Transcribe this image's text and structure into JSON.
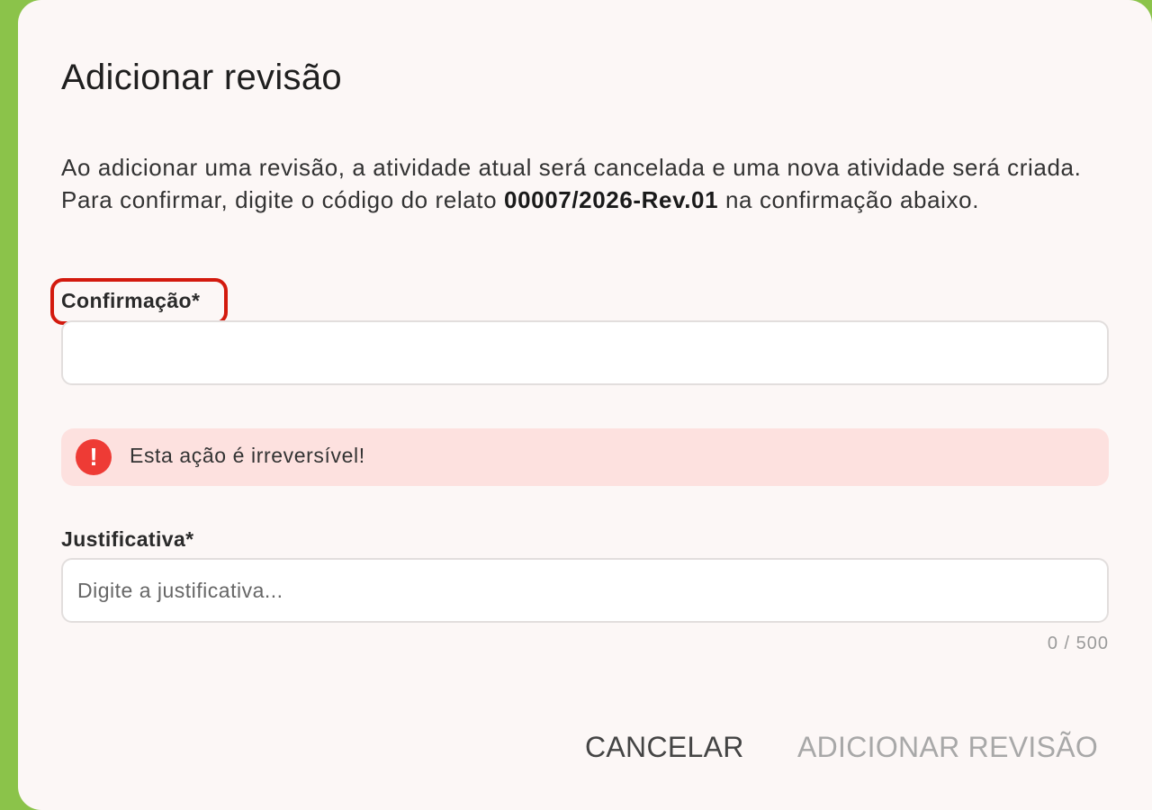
{
  "dialog": {
    "title": "Adicionar revisão",
    "description_before": "Ao adicionar uma revisão, a atividade atual será cancelada e uma nova atividade será criada. Para confirmar, digite o código do relato ",
    "code": "00007/2026-Rev.01",
    "description_after": " na confirmação abaixo."
  },
  "confirmation": {
    "label": "Confirmação*",
    "value": "",
    "placeholder": ""
  },
  "alert": {
    "icon": "!",
    "text": "Esta ação é irreversível!"
  },
  "justification": {
    "label": "Justificativa*",
    "value": "",
    "placeholder": "Digite a justificativa...",
    "counter": "0 / 500"
  },
  "actions": {
    "cancel_label": "CANCELAR",
    "submit_label": "ADICIONAR REVISÃO"
  },
  "colors": {
    "accent_bar": "#8bc34a",
    "alert_bg": "#fde1df",
    "alert_icon": "#ee3b35",
    "highlight_outline": "#d31a0e"
  }
}
